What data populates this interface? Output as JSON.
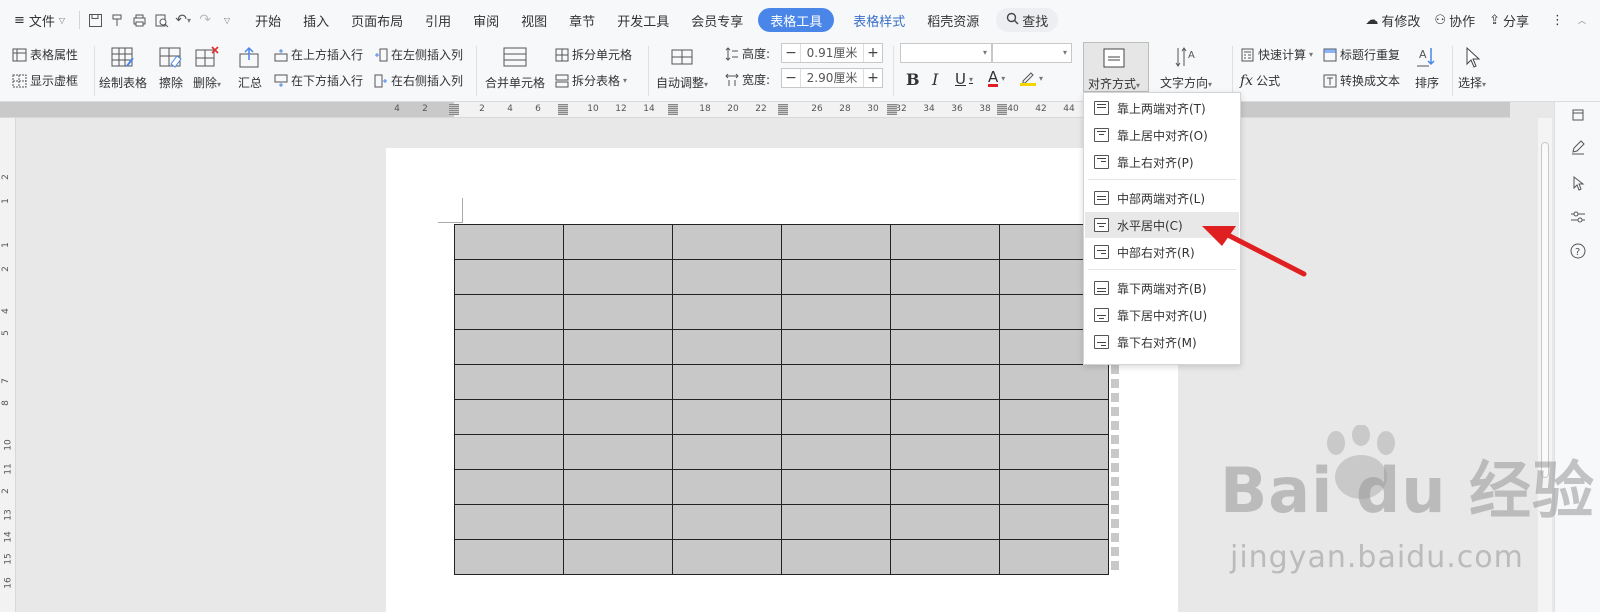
{
  "menubar": {
    "file_label": "文件",
    "tabs": [
      "开始",
      "插入",
      "页面布局",
      "引用",
      "审阅",
      "视图",
      "章节",
      "开发工具",
      "会员专享"
    ],
    "active_tab": "表格工具",
    "style_tab": "表格样式",
    "resource_tab": "稻壳资源",
    "search_label": "查找",
    "right": {
      "modified": "有修改",
      "collab": "协作",
      "share": "分享"
    }
  },
  "toolbar": {
    "table_props": "表格属性",
    "show_grid": "显示虚框",
    "draw_table": "绘制表格",
    "erase": "擦除",
    "delete": "删除",
    "summary": "汇总",
    "insert_above": "在上方插入行",
    "insert_below": "在下方插入行",
    "insert_left": "在左侧插入列",
    "insert_right": "在右侧插入列",
    "merge_cells": "合并单元格",
    "split_cells": "拆分单元格",
    "split_table": "拆分表格",
    "auto_fit": "自动调整",
    "height_label": "高度:",
    "height_value": "0.91厘米",
    "width_label": "宽度:",
    "width_value": "2.90厘米",
    "minus": "−",
    "plus": "+",
    "bold": "B",
    "italic": "I",
    "underline": "U",
    "font_color": "A",
    "align_label": "对齐方式",
    "text_direction": "文字方向",
    "quick_calc": "快速计算",
    "formula": "公式",
    "repeat_header": "标题行重复",
    "convert_text": "转换成文本",
    "sort": "排序",
    "select": "选择"
  },
  "ruler": {
    "h_numbers": [
      "4",
      "2",
      "2",
      "4",
      "6",
      "10",
      "12",
      "14",
      "18",
      "20",
      "22",
      "26",
      "28",
      "30",
      "32",
      "34",
      "36",
      "38",
      "40",
      "42",
      "44"
    ],
    "v_numbers": [
      "2",
      "1",
      "1",
      "2",
      "4",
      "5",
      "7",
      "8",
      "10",
      "11",
      "2",
      "13",
      "14",
      "15",
      "16"
    ]
  },
  "align_menu": {
    "items": [
      {
        "label": "靠上两端对齐(T)",
        "icon": "align-top-justify-icon"
      },
      {
        "label": "靠上居中对齐(O)",
        "icon": "align-top-center-icon"
      },
      {
        "label": "靠上右对齐(P)",
        "icon": "align-top-right-icon"
      },
      {
        "label": "中部两端对齐(L)",
        "icon": "align-middle-justify-icon"
      },
      {
        "label": "水平居中(C)",
        "icon": "align-middle-center-icon"
      },
      {
        "label": "中部右对齐(R)",
        "icon": "align-middle-right-icon"
      },
      {
        "label": "靠下两端对齐(B)",
        "icon": "align-bottom-justify-icon"
      },
      {
        "label": "靠下居中对齐(U)",
        "icon": "align-bottom-center-icon"
      },
      {
        "label": "靠下右对齐(M)",
        "icon": "align-bottom-right-icon"
      }
    ],
    "highlighted": "水平居中(C)"
  },
  "table": {
    "rows": 10,
    "cols": 6
  },
  "watermark": {
    "brand": "Bai du 经验",
    "url": "jingyan.baidu.com"
  },
  "colors": {
    "accent": "#4a86e8",
    "arrow": "#e02020",
    "cell": "#c8c8c8"
  }
}
